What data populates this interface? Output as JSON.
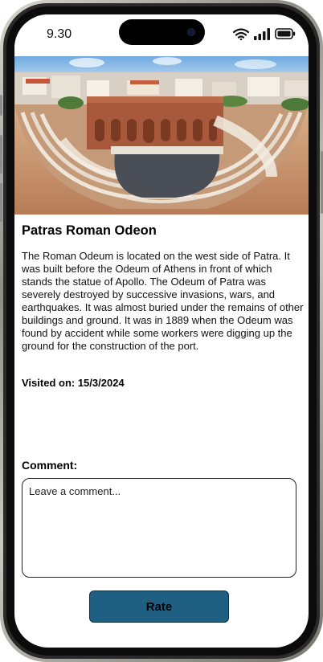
{
  "status_bar": {
    "time": "9.30",
    "icons": [
      "wifi-icon",
      "signal-icon",
      "battery-icon"
    ]
  },
  "hero_image": {
    "subject": "Roman Odeon amphitheater ruins in Patras"
  },
  "place": {
    "title": "Patras Roman Odeon",
    "description": "The Roman Odeum is located on the west side of Patra. It was built  before the Odeum of Athens in front of which stands the statue of  Apollo. The Odeum of Patra was severely destroyed by successive invasions, wars, and earthquakes. It was almost buried under the remains  of other buildings and ground. It was in 1889 when the Odeum was found  by accident while some workers were digging up the ground for the  construction of the port.",
    "visited": "Visited on: 15/3/2024"
  },
  "comment": {
    "label": "Comment:",
    "placeholder": "Leave a comment...",
    "value": ""
  },
  "actions": {
    "rate_label": "Rate"
  },
  "colors": {
    "rate_button": "#1f5f82",
    "frame": "#8f8d86"
  }
}
